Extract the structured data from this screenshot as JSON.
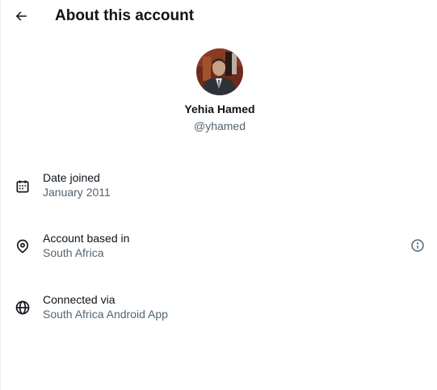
{
  "header": {
    "back_icon": "arrow-left-icon",
    "title": "About this account"
  },
  "profile": {
    "display_name": "Yehia Hamed",
    "handle": "@yhamed"
  },
  "details": [
    {
      "icon": "calendar-icon",
      "label": "Date joined",
      "value": "January 2011"
    },
    {
      "icon": "location-pin-icon",
      "label": "Account based in",
      "value": "South Africa",
      "action_icon": "info-icon"
    },
    {
      "icon": "globe-icon",
      "label": "Connected via",
      "value": "South Africa Android App"
    }
  ],
  "colors": {
    "primary_text": "#0f1419",
    "secondary_text": "#536471"
  }
}
